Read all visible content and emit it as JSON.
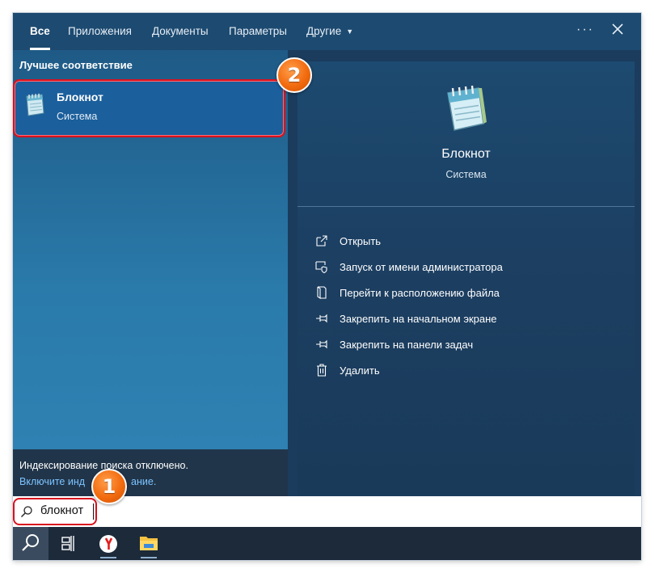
{
  "tabs": [
    {
      "label": "Все",
      "active": true
    },
    {
      "label": "Приложения"
    },
    {
      "label": "Документы"
    },
    {
      "label": "Параметры"
    },
    {
      "label": "Другие"
    }
  ],
  "more_label": "···",
  "best_match": {
    "section_title": "Лучшее соответствие",
    "name": "Блокнот",
    "subtitle": "Система",
    "icon": "notepad-icon"
  },
  "indexing": {
    "text": "Индексирование поиска отключено.",
    "link_visible": "Включите инд",
    "link_tail": "ание."
  },
  "preview": {
    "name": "Блокнот",
    "subtitle": "Система",
    "icon": "notepad-icon",
    "actions": [
      {
        "label": "Открыть",
        "icon": "open-icon"
      },
      {
        "label": "Запуск от имени администратора",
        "icon": "shield-icon"
      },
      {
        "label": "Перейти к расположению файла",
        "icon": "file-location-icon"
      },
      {
        "label": "Закрепить на начальном экране",
        "icon": "pin-icon"
      },
      {
        "label": "Закрепить на панели задач",
        "icon": "pin-icon"
      },
      {
        "label": "Удалить",
        "icon": "trash-icon"
      }
    ]
  },
  "search": {
    "value": "блокнот"
  },
  "taskbar": {
    "items": [
      "search-icon",
      "task-view-icon",
      "yandex-browser-icon",
      "file-explorer-icon"
    ]
  },
  "badges": {
    "one": "1",
    "two": "2"
  },
  "colors": {
    "accent_red": "#d9111e",
    "badge_orange": "#f26b0f",
    "link_blue": "#7cc4ff"
  }
}
